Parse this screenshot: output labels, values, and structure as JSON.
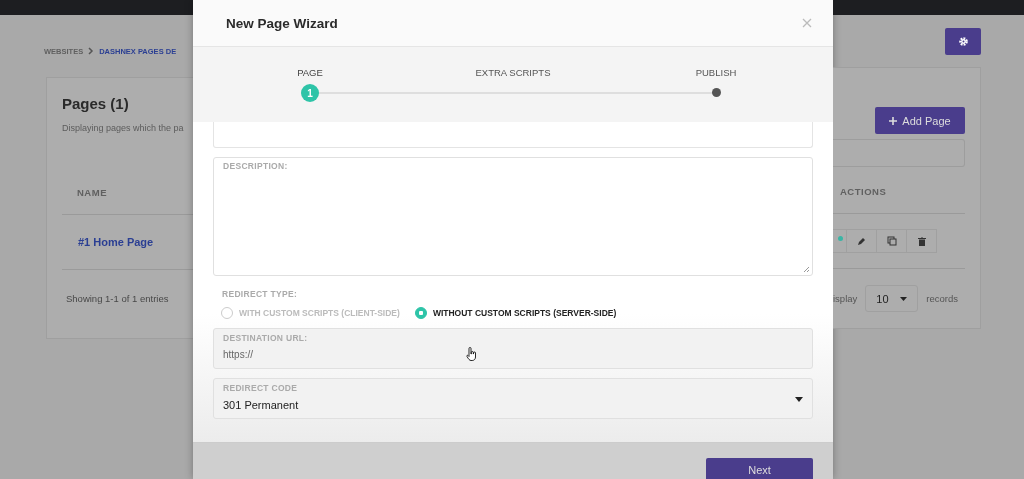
{
  "breadcrumb": [
    {
      "label": "WEBSITES"
    },
    {
      "label": "DASHNEX PAGES DE"
    }
  ],
  "card": {
    "title": "Pages (1)",
    "subtitle": "Displaying pages which the pa",
    "add_button": "Add Page",
    "table": {
      "columns": [
        "NAME",
        "ACTIONS"
      ],
      "rows": [
        {
          "name": "#1 Home Page"
        }
      ]
    },
    "footer": {
      "showing": "Showing 1-1 of 1 entries",
      "display_label": "isplay",
      "page_size": "10",
      "records_label": "records"
    }
  },
  "modal": {
    "title": "New Page Wizard",
    "steps": [
      {
        "label": "PAGE",
        "number": "1",
        "kind": "number",
        "selected": true
      },
      {
        "label": "EXTRA SCRIPTS",
        "kind": "none",
        "selected": false
      },
      {
        "label": "PUBLISH",
        "kind": "dot",
        "selected": false
      }
    ],
    "description_label": "DESCRIPTION:",
    "redirect_type_label": "REDIRECT TYPE:",
    "redirect_options": [
      {
        "label": "WITH CUSTOM SCRIPTS (CLIENT-SIDE)",
        "selected": false
      },
      {
        "label": "WITHOUT CUSTOM SCRIPTS (SERVER-SIDE)",
        "selected": true
      }
    ],
    "destination": {
      "label": "DESTINATION URL:",
      "placeholder": "https://"
    },
    "redirect_code": {
      "label": "REDIRECT CODE",
      "value": "301 Permanent"
    },
    "next_button": "Next"
  }
}
